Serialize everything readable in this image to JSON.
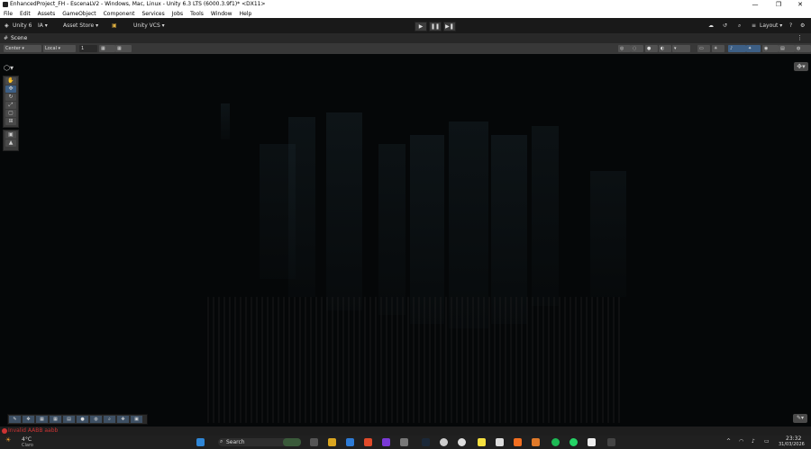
{
  "window": {
    "title": "EnhancedProject_FH - EscenaLV2 - Windows, Mac, Linux - Unity 6.3 LTS (6000.3.9f1)* <DX11>",
    "minimize_label": "—",
    "maximize_label": "❐",
    "close_label": "✕"
  },
  "menu": [
    "File",
    "Edit",
    "Assets",
    "GameObject",
    "Component",
    "Services",
    "Jobs",
    "Tools",
    "Window",
    "Help"
  ],
  "toolbar": {
    "unity_label": "Unity 6",
    "account_label": "IA ▾",
    "asset_store_label": "Asset Store ▾",
    "vcs_label": "Unity VCS ▾",
    "play_label": "▶",
    "pause_label": "❚❚",
    "step_label": "▶❚",
    "layout_label": "Layout ▾"
  },
  "scene_tab": {
    "label": "Scene"
  },
  "scene_toolbar": {
    "pivot_label": "Center ▾",
    "space_label": "Local ▾",
    "snap_value": "1"
  },
  "status": {
    "message": "Invalid AABB aabb"
  },
  "taskbar": {
    "weather_temp": "4°C",
    "weather_desc": "Claro",
    "search_placeholder": "Search",
    "clock_time": "23:32",
    "clock_date": "31/03/2026"
  },
  "colors": {
    "accent": "#4a8fd6",
    "error": "#cc3333",
    "titlebar": "#ffffff",
    "toolbar": "#191919",
    "viewport": "#050708"
  }
}
